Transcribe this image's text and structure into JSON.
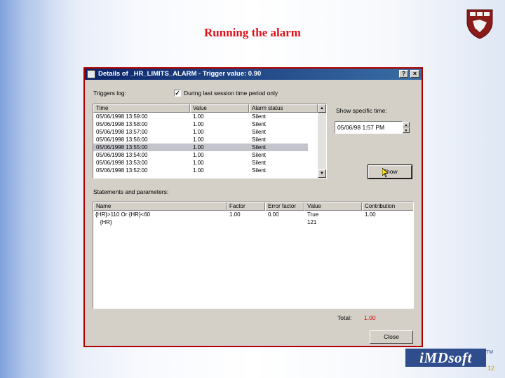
{
  "slide": {
    "title": "Running the alarm",
    "page_number": "12",
    "logo_text": "iMDsoft",
    "logo_tm": "TM"
  },
  "dialog": {
    "title": "Details of _HR_LIMITS_ALARM - Trigger value: 0.90",
    "help_label": "?",
    "close_label": "×",
    "triggers_log_label": "Triggers log:",
    "checkbox_label": "During last session time period only",
    "checkbox_checked": true,
    "show_time_label": "Show specific time:",
    "date_value": "05/06/98   1:57 PM",
    "show_button": "Show",
    "statements_label": "Statements and parameters:",
    "total_label": "Total:",
    "total_value": "1.00",
    "total_color": "#e00000",
    "close_button": "Close",
    "log_table": {
      "columns": [
        "Time",
        "Value",
        "Alarm status"
      ],
      "rows": [
        [
          "05/06/1998 13:59:00",
          "1.00",
          "Silent"
        ],
        [
          "05/06/1998 13:58:00",
          "1.00",
          "Silent"
        ],
        [
          "05/06/1998 13:57:00",
          "1.00",
          "Silent"
        ],
        [
          "05/06/1998 13:56:00",
          "1.00",
          "Silent"
        ],
        [
          "05/06/1998 13:55:00",
          "1.00",
          "Silent"
        ],
        [
          "05/06/1998 13:54:00",
          "1.00",
          "Silent"
        ],
        [
          "05/06/1998 13:53:00",
          "1.00",
          "Silent"
        ],
        [
          "05/06/1998 13:52:00",
          "1.00",
          "Silent"
        ]
      ],
      "selected_row": 4
    },
    "statements_table": {
      "columns": [
        "Name",
        "Factor",
        "Error factor",
        "Value",
        "Contribution"
      ],
      "rows": [
        [
          "{HR}>110 Or {HR}<60",
          "1.00",
          "0.00",
          "True",
          "1.00"
        ],
        [
          "   {HR}",
          "",
          "",
          "121",
          ""
        ]
      ]
    }
  }
}
